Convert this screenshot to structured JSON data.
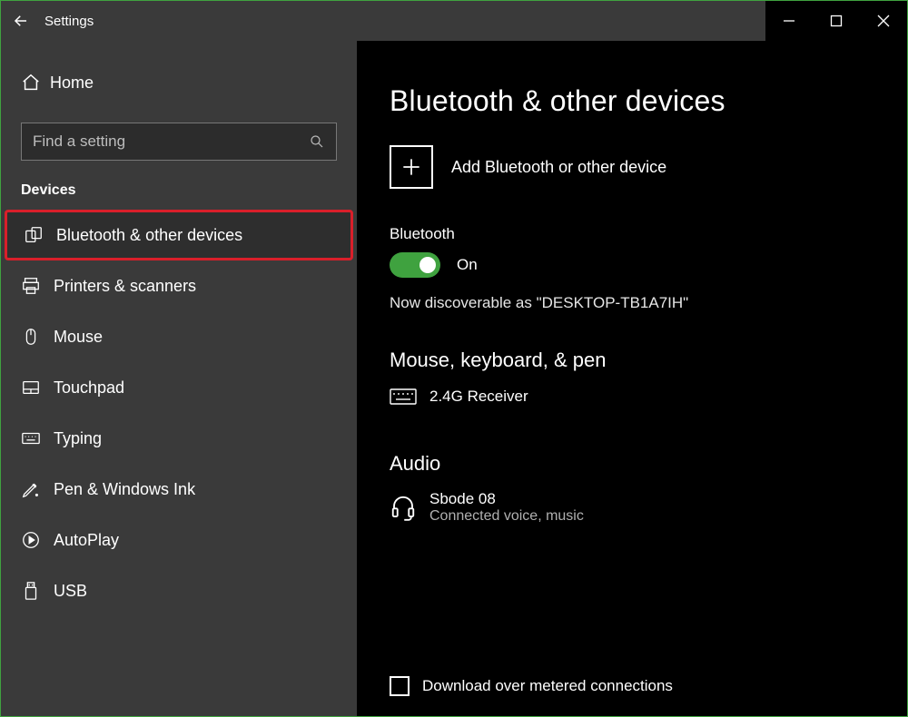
{
  "titlebar": {
    "title": "Settings"
  },
  "sidebar": {
    "home_label": "Home",
    "search_placeholder": "Find a setting",
    "section_title": "Devices",
    "items": [
      {
        "label": "Bluetooth & other devices",
        "icon": "bluetooth-devices-icon",
        "selected": true
      },
      {
        "label": "Printers & scanners",
        "icon": "printer-icon"
      },
      {
        "label": "Mouse",
        "icon": "mouse-icon"
      },
      {
        "label": "Touchpad",
        "icon": "touchpad-icon"
      },
      {
        "label": "Typing",
        "icon": "keyboard-icon"
      },
      {
        "label": "Pen & Windows Ink",
        "icon": "pen-icon"
      },
      {
        "label": "AutoPlay",
        "icon": "autoplay-icon"
      },
      {
        "label": "USB",
        "icon": "usb-icon"
      }
    ]
  },
  "main": {
    "heading": "Bluetooth & other devices",
    "add_label": "Add Bluetooth or other device",
    "bluetooth_label": "Bluetooth",
    "bluetooth_state": "On",
    "discoverable_text": "Now discoverable as \"DESKTOP-TB1A7IH\"",
    "group1_title": "Mouse, keyboard, & pen",
    "device1_name": "2.4G Receiver",
    "group2_title": "Audio",
    "device2_name": "Sbode 08",
    "device2_status": "Connected voice, music",
    "metered_label": "Download over metered connections"
  }
}
